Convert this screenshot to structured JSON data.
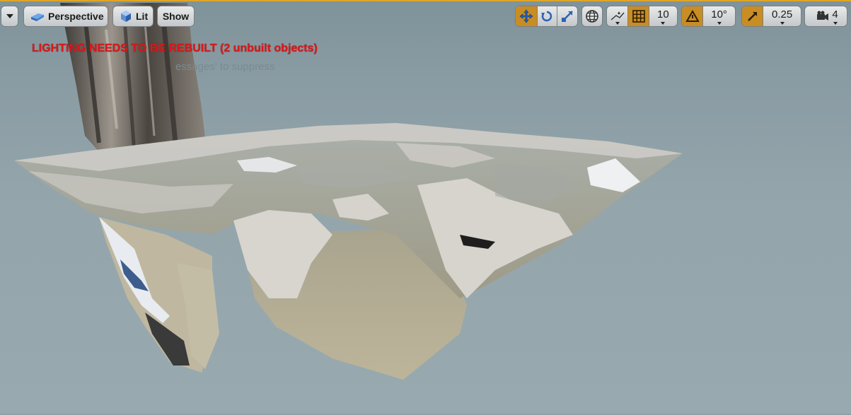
{
  "toolbar_left": {
    "perspective_label": "Perspective",
    "lit_label": "Lit",
    "show_label": "Show"
  },
  "toolbar_right": {
    "grid_snap_value": "10",
    "rotation_snap_value": "10°",
    "scale_snap_value": "0.25",
    "camera_speed_value": "4"
  },
  "messages": {
    "lighting_warning": "LIGHTING NEEDS TO BE REBUILT (2 unbuilt objects)",
    "suppress_hint": "essages' to suppress"
  },
  "colors": {
    "accent": "#c88d23",
    "warning": "#d9191a",
    "viewport_sky": "#8a9ca3"
  },
  "icons": {
    "view_options": "chevron-down-icon",
    "perspective": "cube-icon",
    "lit": "lit-sphere-icon",
    "translate": "move-icon",
    "rotate": "rotate-icon",
    "scale": "scale-icon",
    "world_local": "globe-icon",
    "surface_snap": "surface-snap-icon",
    "grid_snap": "grid-icon",
    "rotation_snap": "angle-icon",
    "scale_snap": "scale-snap-icon",
    "camera_speed": "camera-icon"
  }
}
